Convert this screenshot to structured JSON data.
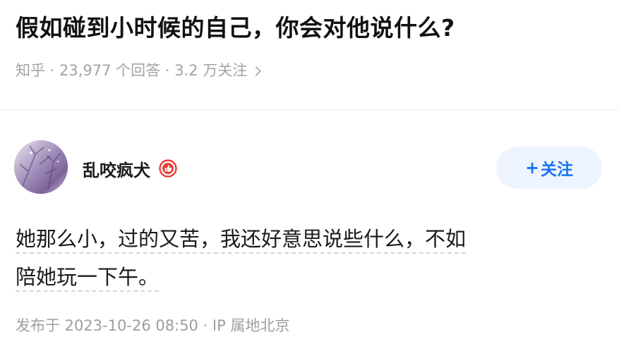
{
  "question": {
    "title": "假如碰到小时候的自己，你会对他说什么?",
    "meta": "知乎 · 23,977 个回答 · 3.2 万关注"
  },
  "answer": {
    "author": {
      "name": "乱咬疯犬",
      "badge_icon": "like-badge-icon"
    },
    "follow_label": "关注",
    "follow_prefix": "+",
    "content_lines": [
      "她那么小，过的又苦，我还好意思说些什么，不如",
      "陪她玩一下午。"
    ],
    "publish_info": "发布于 2023-10-26 08:50 · IP 属地北京"
  },
  "colors": {
    "accent": "#1772f6",
    "follow_bg": "#eef4ff",
    "badge": "#e4403a",
    "meta_text": "#a3a3a3"
  }
}
